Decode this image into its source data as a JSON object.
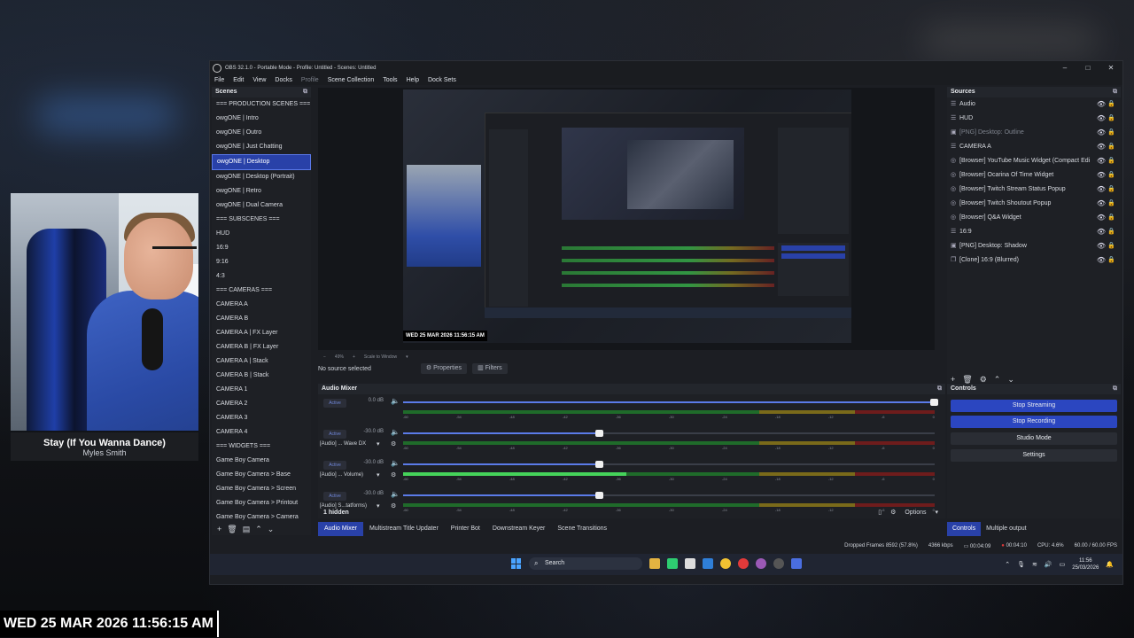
{
  "overlay": {
    "song_title": "Stay (If You Wanna Dance)",
    "song_artist": "Myles Smith",
    "clock": "WED 25 MAR 2026 11:56:15 AM"
  },
  "window": {
    "title": "OBS 32.1.0 - Portable Mode - Profile: Untitled - Scenes: Untitled",
    "minimize": "–",
    "maximize": "□",
    "close": "✕"
  },
  "menu": [
    "File",
    "Edit",
    "View",
    "Docks",
    "Profile",
    "Scene Collection",
    "Tools",
    "Help",
    "Dock Sets"
  ],
  "scenes": {
    "header": "Scenes",
    "items": [
      "=== PRODUCTION SCENES ===",
      "owgONE | Intro",
      "owgONE | Outro",
      "owgONE | Just Chatting",
      "owgONE | Desktop",
      "owgONE | Desktop (Portrait)",
      "owgONE | Retro",
      "owgONE | Dual Camera",
      "=== SUBSCENES ===",
      "HUD",
      "16:9",
      "9:16",
      "4:3",
      "=== CAMERAS ===",
      "CAMERA A",
      "CAMERA B",
      "CAMERA A | FX Layer",
      "CAMERA B | FX Layer",
      "CAMERA A | Stack",
      "CAMERA B | Stack",
      "CAMERA 1",
      "CAMERA 2",
      "CAMERA 3",
      "CAMERA 4",
      "=== WIDGETS ===",
      "Game Boy Camera",
      "Game Boy Camera > Base",
      "Game Boy Camera > Screen",
      "Game Boy Camera > Printout",
      "Game Boy Camera > Camera"
    ],
    "selected_index": 4
  },
  "preview": {
    "stamp": "WED 25 MAR 2026 11:56:15 AM",
    "zoom": "49%",
    "scale_mode": "Scale to Window"
  },
  "source_bar": {
    "no_source": "No source selected",
    "properties": "Properties",
    "filters": "Filters"
  },
  "sources": {
    "header": "Sources",
    "items": [
      {
        "icon": "list-icon",
        "label": "Audio",
        "dim": false
      },
      {
        "icon": "list-icon",
        "label": "HUD",
        "dim": false
      },
      {
        "icon": "image-icon",
        "label": "[PNG] Desktop: Outline",
        "dim": true
      },
      {
        "icon": "list-icon",
        "label": "CAMERA A",
        "dim": false
      },
      {
        "icon": "globe-icon",
        "label": "[Browser] YouTube Music Widget (Compact Edi",
        "dim": false
      },
      {
        "icon": "globe-icon",
        "label": "[Browser] Ocarina Of Time Widget",
        "dim": false
      },
      {
        "icon": "globe-icon",
        "label": "[Browser] Twitch Stream Status Popup",
        "dim": false
      },
      {
        "icon": "globe-icon",
        "label": "[Browser] Twitch Shoutout Popup",
        "dim": false
      },
      {
        "icon": "globe-icon",
        "label": "[Browser] Q&A Widget",
        "dim": false
      },
      {
        "icon": "list-icon",
        "label": "16:9",
        "dim": false
      },
      {
        "icon": "image-icon",
        "label": "[PNG] Desktop: Shadow",
        "dim": false
      },
      {
        "icon": "clone-icon",
        "label": "[Clone] 16:9 (Blurred)",
        "dim": false
      }
    ]
  },
  "mixer": {
    "header": "Audio Mixer",
    "channels": [
      {
        "status": "Active",
        "db": "0.0 dB",
        "name": "",
        "level": 0.0,
        "fader": 1.0
      },
      {
        "status": "Active",
        "db": "-30.0 dB",
        "name": "[Audio] ... Wave DX",
        "level": 0.0,
        "fader": 0.37
      },
      {
        "status": "Active",
        "db": "-30.0 dB",
        "name": "[Audio] ... Volume)",
        "level": 0.42,
        "fader": 0.37
      },
      {
        "status": "Active",
        "db": "-30.0 dB",
        "name": "[Audio] S...tatforms)",
        "level": 0.0,
        "fader": 0.37
      }
    ],
    "ticks": [
      "-60",
      "-54",
      "-48",
      "-42",
      "-36",
      "-30",
      "-24",
      "-18",
      "-12",
      "-6",
      "0"
    ],
    "hidden": "1 hidden",
    "options": "Options"
  },
  "tabs": [
    "Audio Mixer",
    "Multistream Title Updater",
    "Printer Bot",
    "Downstream Keyer",
    "Scene Transitions"
  ],
  "controls": {
    "header": "Controls",
    "buttons": [
      {
        "label": "Stop Streaming",
        "style": "blue"
      },
      {
        "label": "Stop Recording",
        "style": "blue"
      },
      {
        "label": "Studio Mode",
        "style": "plain"
      },
      {
        "label": "Settings",
        "style": "plain"
      }
    ],
    "tabs": [
      "Controls",
      "Multiple output"
    ]
  },
  "status": {
    "dropped": "Dropped Frames 8592 (57.8%)",
    "kbps": "4366 kbps",
    "stream_time": "00:04:09",
    "rec_time": "00:04:10",
    "cpu": "CPU: 4.6%",
    "fps": "60.00 / 60.00 FPS"
  },
  "taskbar": {
    "search": "Search",
    "time": "11:56",
    "date": "25/03/2026"
  },
  "colors": {
    "accent": "#2941a8",
    "meter_green": "#45d35a",
    "meter_yellow": "#7a6a1a",
    "meter_red": "#6e1c1c"
  }
}
